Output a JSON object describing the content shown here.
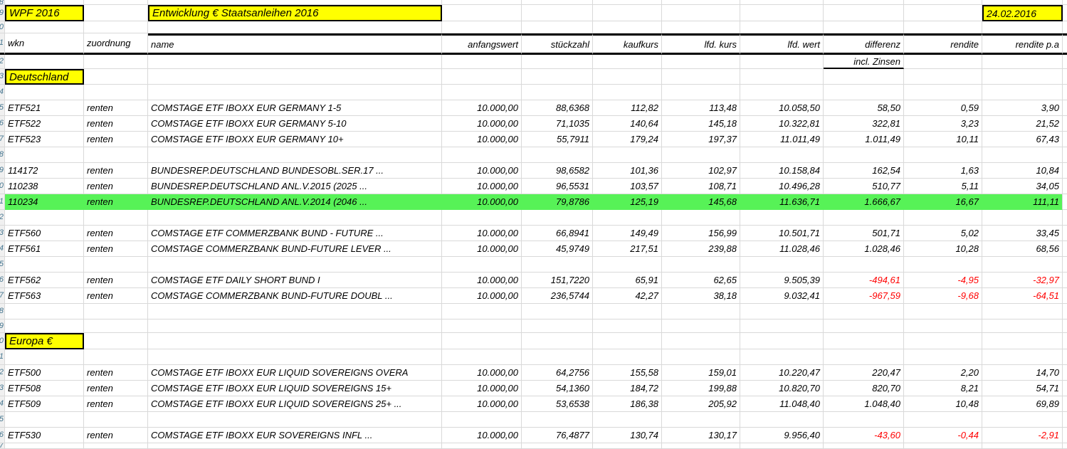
{
  "header": {
    "workbook_label": "WPF 2016",
    "title": "Entwicklung € Staatsanleihen 2016",
    "date": "24.02.2016"
  },
  "columns": [
    "wkn",
    "zuordnung",
    "name",
    "anfangswert",
    "stückzahl",
    "kaufkurs",
    "lfd. kurs",
    "lfd. wert",
    "differenz",
    "rendite",
    "rendite p.a"
  ],
  "subheader_note": "incl. Zinsen",
  "colors": {
    "highlight_yellow": "#ffff00",
    "highlight_green": "#57f257",
    "negative_red": "#ff0000",
    "gridline": "#d9d9d9"
  },
  "rows": [
    {
      "n": 8,
      "type": "spacer",
      "h": 7
    },
    {
      "n": 9,
      "type": "titles",
      "h": 23
    },
    {
      "n": 10,
      "type": "spacer",
      "h": 17
    },
    {
      "n": 11,
      "type": "header",
      "h": 30
    },
    {
      "n": 12,
      "type": "subheader",
      "h": 20
    },
    {
      "n": 13,
      "type": "section",
      "h": 22,
      "label": "Deutschland"
    },
    {
      "n": 14,
      "type": "spacer",
      "h": 22
    },
    {
      "n": 15,
      "type": "data",
      "h": 22,
      "wkn": "ETF521",
      "zuordnung": "renten",
      "name": "COMSTAGE ETF IBOXX EUR GERMANY 1-5",
      "values": [
        "10.000,00",
        "88,6368",
        "112,82",
        "113,48",
        "10.058,50",
        "58,50",
        "0,59",
        "3,90"
      ]
    },
    {
      "n": 16,
      "type": "data",
      "h": 22,
      "wkn": "ETF522",
      "zuordnung": "renten",
      "name": "COMSTAGE ETF IBOXX EUR GERMANY 5-10",
      "values": [
        "10.000,00",
        "71,1035",
        "140,64",
        "145,18",
        "10.322,81",
        "322,81",
        "3,23",
        "21,52"
      ]
    },
    {
      "n": 17,
      "type": "data",
      "h": 22,
      "wkn": "ETF523",
      "zuordnung": "renten",
      "name": "COMSTAGE ETF IBOXX EUR GERMANY 10+",
      "values": [
        "10.000,00",
        "55,7911",
        "179,24",
        "197,37",
        "11.011,49",
        "1.011,49",
        "10,11",
        "67,43"
      ]
    },
    {
      "n": 18,
      "type": "spacer",
      "h": 22
    },
    {
      "n": 19,
      "type": "data",
      "h": 22,
      "wkn": "114172",
      "zuordnung": "renten",
      "name": "BUNDESREP.DEUTSCHLAND BUNDESOBL.SER.17 ...",
      "values": [
        "10.000,00",
        "98,6582",
        "101,36",
        "102,97",
        "10.158,84",
        "162,54",
        "1,63",
        "10,84"
      ]
    },
    {
      "n": 20,
      "type": "data",
      "h": 22,
      "wkn": "110238",
      "zuordnung": "renten",
      "name": "BUNDESREP.DEUTSCHLAND ANL.V.2015 (2025 ...",
      "values": [
        "10.000,00",
        "96,5531",
        "103,57",
        "108,71",
        "10.496,28",
        "510,77",
        "5,11",
        "34,05"
      ]
    },
    {
      "n": 21,
      "type": "data",
      "h": 22,
      "highlight": true,
      "wkn": "110234",
      "zuordnung": "renten",
      "name": "BUNDESREP.DEUTSCHLAND ANL.V.2014 (2046 ...",
      "values": [
        "10.000,00",
        "79,8786",
        "125,19",
        "145,68",
        "11.636,71",
        "1.666,67",
        "16,67",
        "111,11"
      ]
    },
    {
      "n": 22,
      "type": "spacer",
      "h": 22
    },
    {
      "n": 23,
      "type": "data",
      "h": 22,
      "wkn": "ETF560",
      "zuordnung": "renten",
      "name": "COMSTAGE ETF COMMERZBANK BUND - FUTURE ...",
      "values": [
        "10.000,00",
        "66,8941",
        "149,49",
        "156,99",
        "10.501,71",
        "501,71",
        "5,02",
        "33,45"
      ]
    },
    {
      "n": 24,
      "type": "data",
      "h": 22,
      "wkn": "ETF561",
      "zuordnung": "renten",
      "name": "COMSTAGE COMMERZBANK BUND-FUTURE LEVER ...",
      "values": [
        "10.000,00",
        "45,9749",
        "217,51",
        "239,88",
        "11.028,46",
        "1.028,46",
        "10,28",
        "68,56"
      ]
    },
    {
      "n": 25,
      "type": "spacer",
      "h": 22
    },
    {
      "n": 26,
      "type": "data",
      "h": 22,
      "wkn": "ETF562",
      "zuordnung": "renten",
      "name": "COMSTAGE ETF DAILY SHORT BUND I",
      "values": [
        "10.000,00",
        "151,7220",
        "65,91",
        "62,65",
        "9.505,39",
        "-494,61",
        "-4,95",
        "-32,97"
      ]
    },
    {
      "n": 27,
      "type": "data",
      "h": 22,
      "wkn": "ETF563",
      "zuordnung": "renten",
      "name": "COMSTAGE COMMERZBANK BUND-FUTURE DOUBL ...",
      "values": [
        "10.000,00",
        "236,5744",
        "42,27",
        "38,18",
        "9.032,41",
        "-967,59",
        "-9,68",
        "-64,51"
      ]
    },
    {
      "n": 28,
      "type": "spacer",
      "h": 22
    },
    {
      "n": 29,
      "type": "spacer",
      "h": 19
    },
    {
      "n": 30,
      "type": "section",
      "h": 23,
      "label": "Europa €"
    },
    {
      "n": 31,
      "type": "spacer",
      "h": 22
    },
    {
      "n": 32,
      "type": "data",
      "h": 22,
      "wkn": "ETF500",
      "zuordnung": "renten",
      "name": "COMSTAGE ETF IBOXX EUR LIQUID SOVEREIGNS OVERA",
      "values": [
        "10.000,00",
        "64,2756",
        "155,58",
        "159,01",
        "10.220,47",
        "220,47",
        "2,20",
        "14,70"
      ]
    },
    {
      "n": 33,
      "type": "data",
      "h": 22,
      "wkn": "ETF508",
      "zuordnung": "renten",
      "name": "COMSTAGE ETF IBOXX EUR LIQUID SOVEREIGNS 15+",
      "values": [
        "10.000,00",
        "54,1360",
        "184,72",
        "199,88",
        "10.820,70",
        "820,70",
        "8,21",
        "54,71"
      ]
    },
    {
      "n": 34,
      "type": "data",
      "h": 22,
      "wkn": "ETF509",
      "zuordnung": "renten",
      "name": "COMSTAGE ETF IBOXX EUR LIQUID SOVEREIGNS 25+ ...",
      "values": [
        "10.000,00",
        "53,6538",
        "186,38",
        "205,92",
        "11.048,40",
        "1.048,40",
        "10,48",
        "69,89"
      ]
    },
    {
      "n": 35,
      "type": "spacer",
      "h": 22
    },
    {
      "n": 36,
      "type": "data",
      "h": 22,
      "wkn": "ETF530",
      "zuordnung": "renten",
      "name": "COMSTAGE ETF IBOXX EUR SOVEREIGNS INFL ...",
      "values": [
        "10.000,00",
        "76,4877",
        "130,74",
        "130,17",
        "9.956,40",
        "-43,60",
        "-0,44",
        "-2,91"
      ]
    },
    {
      "n": 37,
      "type": "spacer",
      "h": 8
    }
  ]
}
